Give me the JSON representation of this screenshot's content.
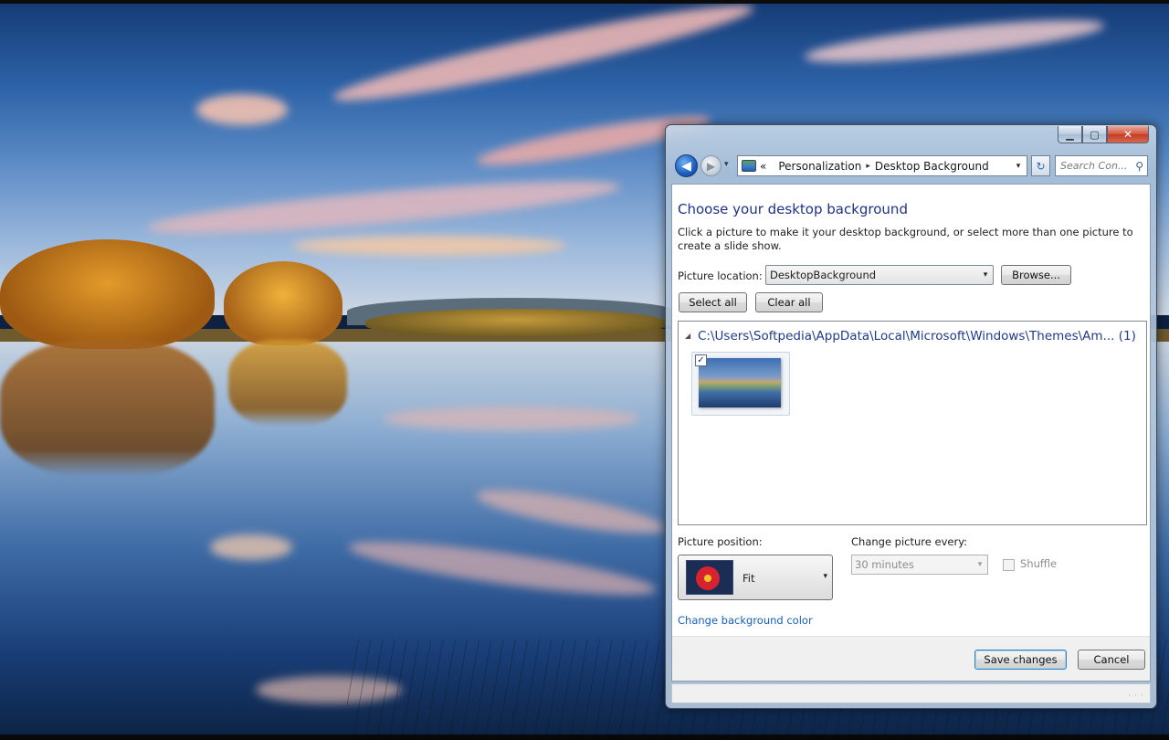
{
  "window": {
    "caption_buttons": {
      "minimize": "▁",
      "maximize": "▢",
      "close": "✕"
    }
  },
  "navigation": {
    "back_glyph": "◀",
    "forward_glyph": "▶",
    "recent_glyph": "▾",
    "breadcrumb_prefix": "«",
    "breadcrumb": [
      "Personalization",
      "Desktop Background"
    ],
    "breadcrumb_separator": "▸",
    "address_dropdown_glyph": "▾",
    "refresh_glyph": "↻",
    "search_placeholder": "Search Con...",
    "search_glyph": "⚲"
  },
  "content": {
    "heading": "Choose your desktop background",
    "description": "Click a picture to make it your desktop background, or select more than one picture to create a slide show.",
    "picture_location": {
      "label": "Picture location:",
      "value": "DesktopBackground",
      "arrow": "▾"
    },
    "browse_label": "Browse...",
    "select_all_label": "Select all",
    "clear_all_label": "Clear all",
    "picture_group": {
      "toggle_glyph": "◢",
      "path": "C:\\Users\\Softpedia\\AppData\\Local\\Microsoft\\Windows\\Themes\\Am...",
      "count": "(1)",
      "checked": true,
      "check_glyph": "✓"
    },
    "picture_position": {
      "label": "Picture position:",
      "value": "Fit",
      "arrow": "▾"
    },
    "change_picture": {
      "label": "Change picture every:",
      "value": "30 minutes",
      "arrow": "▾",
      "enabled": false
    },
    "shuffle": {
      "label": "Shuffle",
      "checked": false,
      "enabled": false
    },
    "background_color_link": "Change background color"
  },
  "footer": {
    "save_label": "Save changes",
    "cancel_label": "Cancel"
  },
  "statusbar": {
    "grip": "· · ·"
  },
  "icons": {
    "back": "back-arrow-icon",
    "forward": "forward-arrow-icon",
    "address": "personalization-monitor-icon",
    "refresh": "refresh-icon",
    "search": "search-icon",
    "position_preview": "flower-icon"
  },
  "colors": {
    "heading": "#1e3287",
    "link": "#1560bd",
    "group_header": "#1e3b8c",
    "accent": "#3c7fb1"
  }
}
